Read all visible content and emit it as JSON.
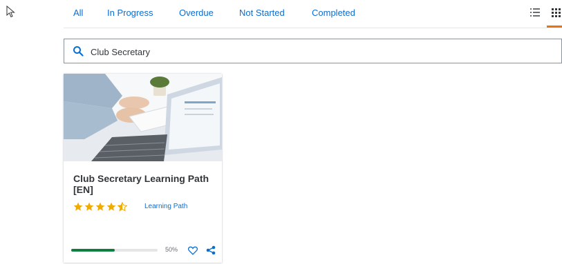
{
  "tabs": [
    {
      "label": "All"
    },
    {
      "label": "In Progress"
    },
    {
      "label": "Overdue"
    },
    {
      "label": "Not Started"
    },
    {
      "label": "Completed"
    }
  ],
  "view": {
    "active": "grid",
    "accent_color": "#e9730c"
  },
  "search": {
    "value": "Club Secretary"
  },
  "card": {
    "title": "Club Secretary Learning Path [EN]",
    "rating": 4.5,
    "type_label": "Learning Path",
    "progress_percent": 50,
    "progress_text": "50%",
    "progress_color": "#107e3e",
    "star_color": "#f0ab00"
  },
  "colors": {
    "link": "#0a6ed1",
    "text": "#32363a"
  }
}
